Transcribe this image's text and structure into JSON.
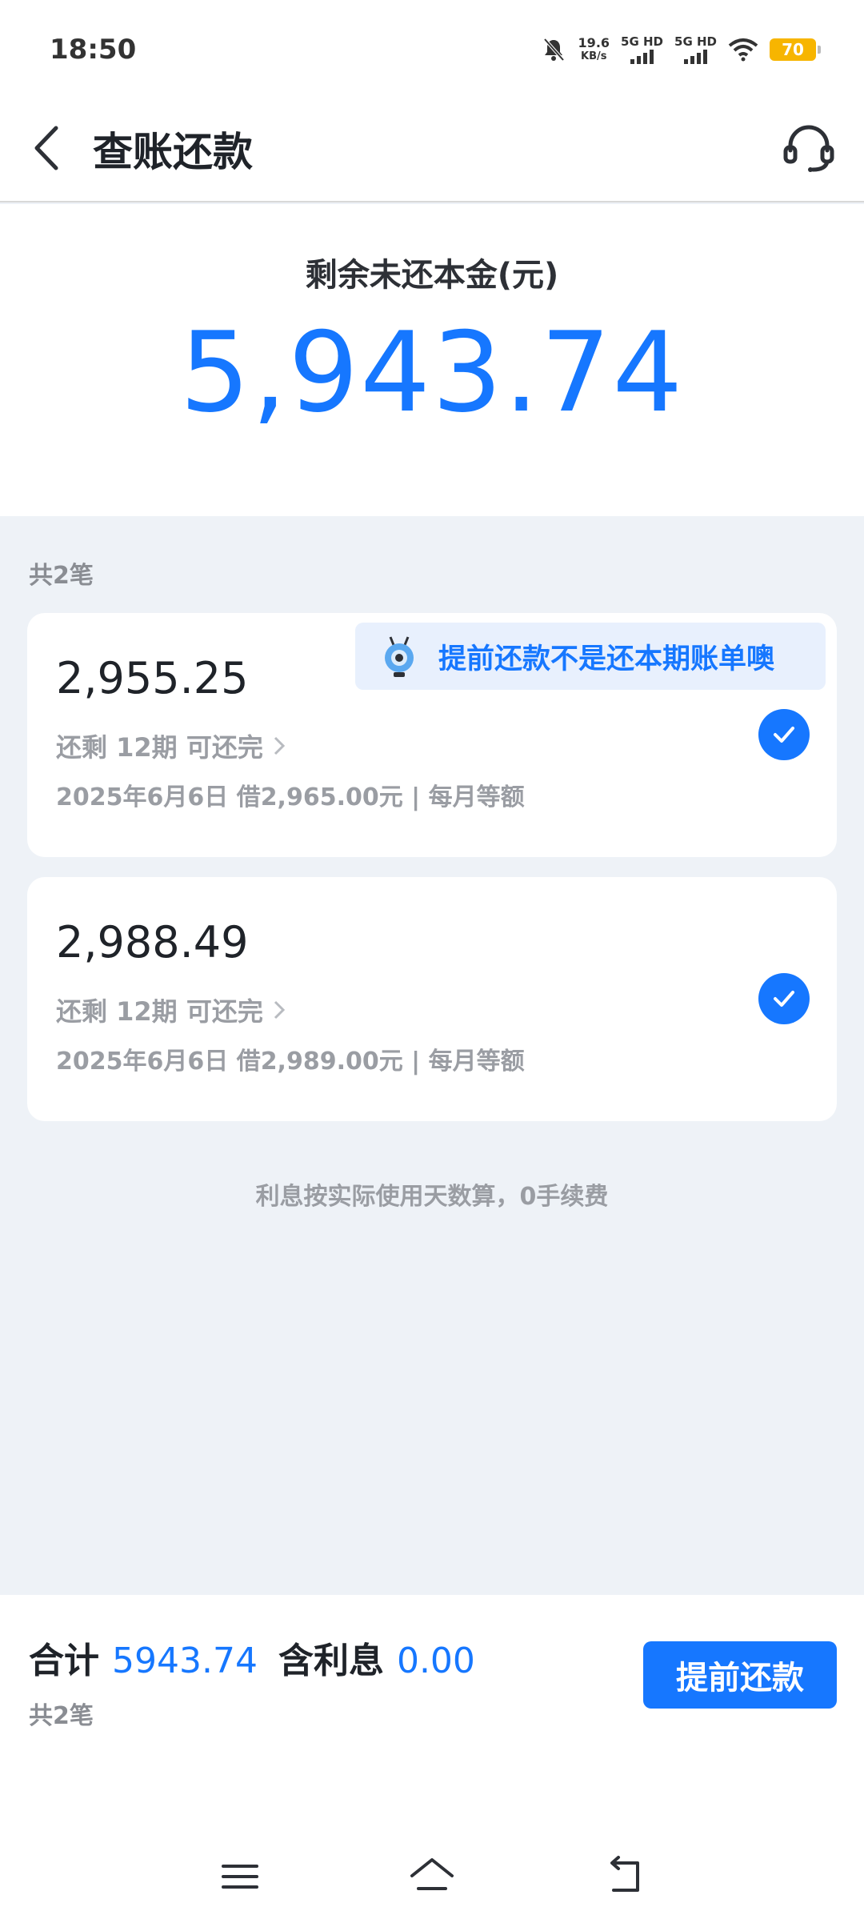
{
  "status_bar": {
    "time": "18:50",
    "speed_value": "19.6",
    "speed_unit": "KB/s",
    "net1": "5G HD",
    "net2": "5G HD",
    "battery": "70"
  },
  "nav": {
    "title": "查账还款"
  },
  "summary": {
    "label": "剩余未还本金(元)",
    "amount": "5,943.74"
  },
  "list": {
    "count_label": "共2笔",
    "tip": "提前还款不是还本期账单噢",
    "loans": [
      {
        "amount": "2,955.25",
        "remain": "还剩 12期 可还完",
        "detail": "2025年6月6日 借2,965.00元 | 每月等额",
        "checked": true
      },
      {
        "amount": "2,988.49",
        "remain": "还剩 12期 可还完",
        "detail": "2025年6月6日 借2,989.00元 | 每月等额",
        "checked": true
      }
    ],
    "footnote": "利息按实际使用天数算，0手续费"
  },
  "footer": {
    "total_label": "合计",
    "total_value": "5943.74",
    "interest_label": "含利息",
    "interest_value": "0.00",
    "count_label": "共2笔",
    "repay_button": "提前还款"
  },
  "colors": {
    "accent": "#1677ff",
    "background": "#eef2f7",
    "battery": "#f7b500"
  }
}
